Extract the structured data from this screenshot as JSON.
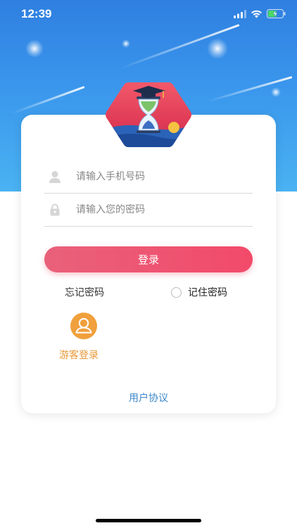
{
  "status_bar": {
    "time": "12:39"
  },
  "login_form": {
    "phone_placeholder": "请输入手机号码",
    "password_placeholder": "请输入您的密码",
    "login_label": "登录",
    "forgot_password_label": "忘记密码",
    "remember_password_label": "记住密码",
    "remember_password_checked": false
  },
  "guest_login": {
    "label": "游客登录"
  },
  "footer": {
    "user_agreement_label": "用户协议"
  },
  "colors": {
    "sky_top": "#2f7fe0",
    "sky_bottom": "#4ab3f2",
    "login_button": "#f24a6a",
    "guest_accent": "#f0a03c",
    "link": "#3b86c8"
  },
  "icons": {
    "logo": "hourglass-graduation-cap-logo",
    "phone_field": "user-icon",
    "password_field": "lock-icon",
    "guest": "person-icon"
  }
}
